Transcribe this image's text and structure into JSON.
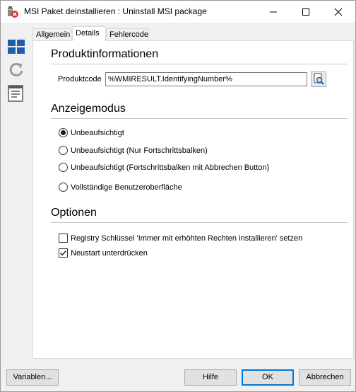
{
  "window": {
    "title": "MSI Paket deinstallieren : Uninstall MSI package",
    "controls": {
      "minimize": "—",
      "maximize": "☐",
      "close": "✕"
    }
  },
  "toolbar": {
    "icons": [
      "windows-grid-icon",
      "refresh-icon",
      "document-list-icon"
    ]
  },
  "tabs": [
    {
      "label": "Allgemein",
      "active": false
    },
    {
      "label": "Details",
      "active": true
    },
    {
      "label": "Fehlercode",
      "active": false
    }
  ],
  "product_info": {
    "heading": "Produktinformationen",
    "product_code_label": "Produktcode",
    "product_code_value": "%WMIRESULT.IdentifyingNumber%"
  },
  "display_mode": {
    "heading": "Anzeigemodus",
    "options": [
      {
        "label": "Unbeaufsichtigt",
        "checked": true
      },
      {
        "label": "Unbeaufsichtigt (Nur Fortschrittsbalken)",
        "checked": false
      },
      {
        "label": "Unbeaufsichtigt (Fortschrittsbalken mit Abbrechen Button)",
        "checked": false
      },
      {
        "label": "Vollständige Benutzeroberfläche",
        "checked": false
      }
    ]
  },
  "options": {
    "heading": "Optionen",
    "items": [
      {
        "label": "Registry Schlüssel 'Immer mit erhöhten Rechten installieren' setzen",
        "checked": false
      },
      {
        "label": "Neustart unterdrücken",
        "checked": true
      }
    ]
  },
  "buttons": {
    "variables": "Variablen...",
    "help": "Hilfe",
    "ok": "OK",
    "cancel": "Abbrechen"
  },
  "colors": {
    "accent": "#0078d7",
    "toolbar_blue": "#1e5fa8",
    "close_badge": "#d9302c"
  }
}
